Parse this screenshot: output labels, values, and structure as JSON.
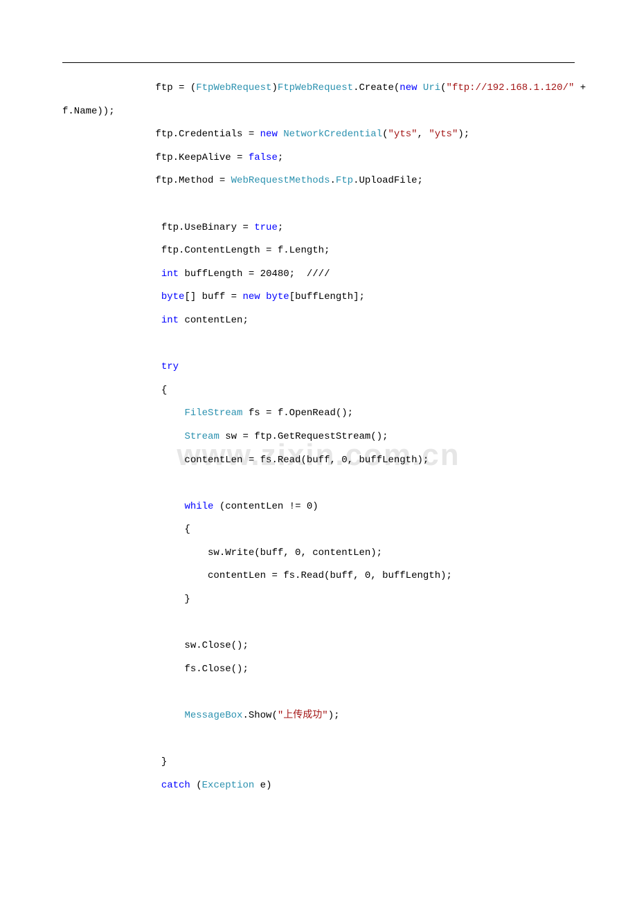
{
  "watermark": "www.zixin.com.cn",
  "code": {
    "l1_a": "                ftp = (",
    "l1_b": "FtpWebRequest",
    "l1_c": ")",
    "l1_d": "FtpWebRequest",
    "l1_e": ".Create(",
    "l1_f": "new",
    "l1_g": " ",
    "l1_h": "Uri",
    "l1_i": "(",
    "l1_j": "\"ftp://192.168.1.120/\"",
    "l1_k": " + ",
    "l2": "f.Name));",
    "l3_a": "                ftp.Credentials = ",
    "l3_b": "new",
    "l3_c": " ",
    "l3_d": "NetworkCredential",
    "l3_e": "(",
    "l3_f": "\"yts\"",
    "l3_g": ", ",
    "l3_h": "\"yts\"",
    "l3_i": ");",
    "l4_a": "                ftp.KeepAlive = ",
    "l4_b": "false",
    "l4_c": ";",
    "l5_a": "                ftp.Method = ",
    "l5_b": "WebRequestMethods",
    "l5_c": ".",
    "l5_d": "Ftp",
    "l5_e": ".UploadFile;",
    "l6": "",
    "l7_a": "                 ftp.UseBinary = ",
    "l7_b": "true",
    "l7_c": ";",
    "l8": "                 ftp.ContentLength = f.Length;",
    "l9_a": "                 ",
    "l9_b": "int",
    "l9_c": " buffLength = 20480;  ////",
    "l10_a": "                 ",
    "l10_b": "byte",
    "l10_c": "[] buff = ",
    "l10_d": "new",
    "l10_e": " ",
    "l10_f": "byte",
    "l10_g": "[buffLength];",
    "l11_a": "                 ",
    "l11_b": "int",
    "l11_c": " contentLen;",
    "l12": "",
    "l13_a": "                 ",
    "l13_b": "try",
    "l14": "                 {",
    "l15_a": "                     ",
    "l15_b": "FileStream",
    "l15_c": " fs = f.OpenRead();",
    "l16_a": "                     ",
    "l16_b": "Stream",
    "l16_c": " sw = ftp.GetRequestStream();",
    "l17": "                     contentLen = fs.Read(buff, 0, buffLength);",
    "l18": "",
    "l19_a": "                     ",
    "l19_b": "while",
    "l19_c": " (contentLen != 0)",
    "l20": "                     {",
    "l21": "                         sw.Write(buff, 0, contentLen);",
    "l22": "                         contentLen = fs.Read(buff, 0, buffLength);",
    "l23": "                     }",
    "l24": "",
    "l25": "                     sw.Close();",
    "l26": "                     fs.Close();",
    "l27": "",
    "l28_a": "                     ",
    "l28_b": "MessageBox",
    "l28_c": ".Show(",
    "l28_d": "\"上传成功\"",
    "l28_e": ");",
    "l29": "",
    "l30": "                 }",
    "l31_a": "                 ",
    "l31_b": "catch",
    "l31_c": " (",
    "l31_d": "Exception",
    "l31_e": " e)"
  }
}
